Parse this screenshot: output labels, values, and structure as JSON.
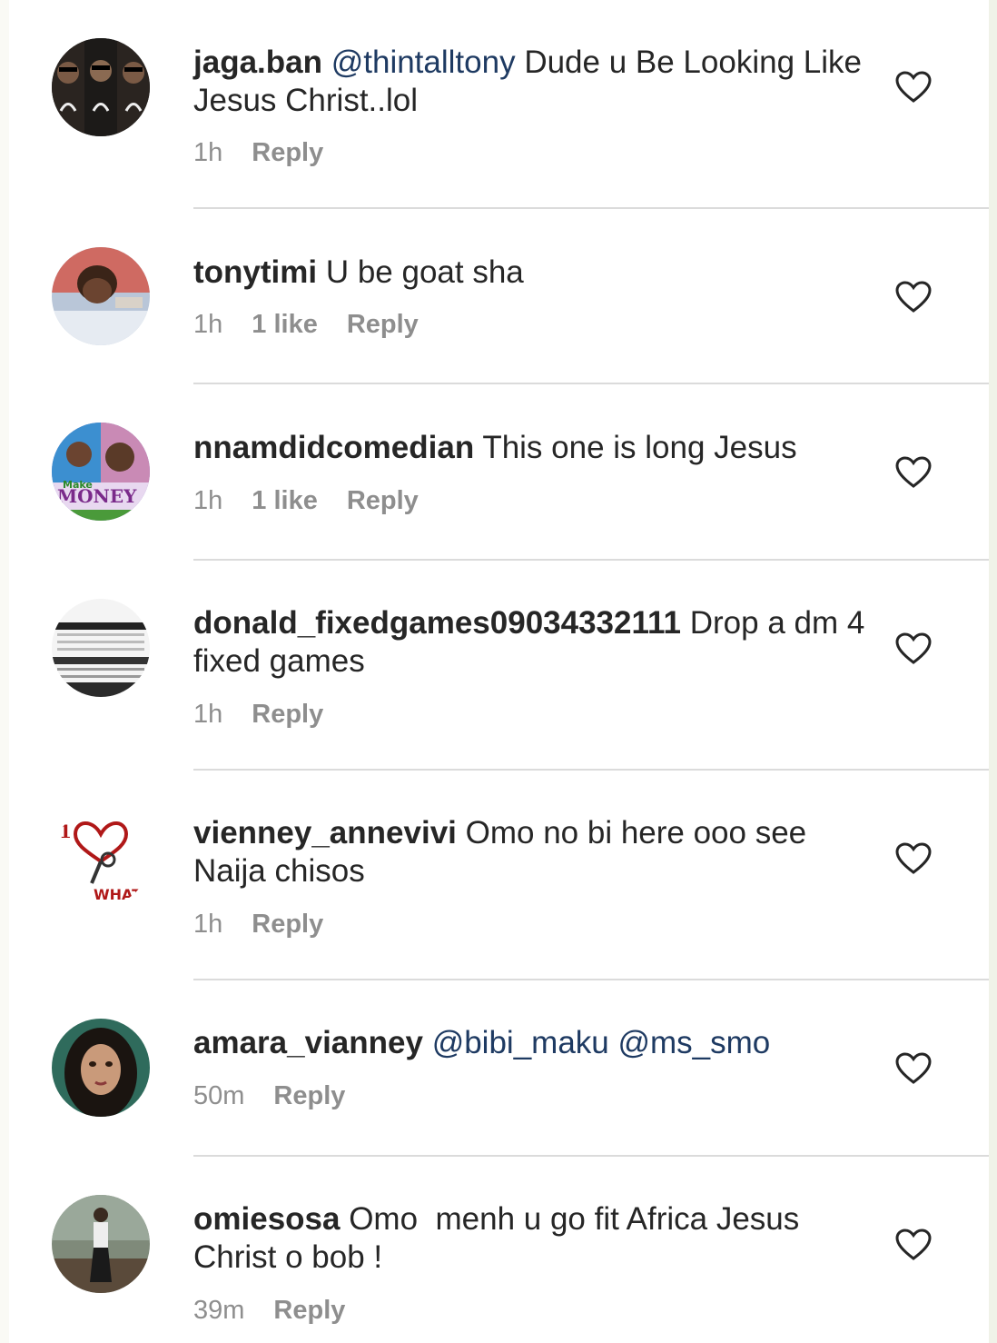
{
  "comments": [
    {
      "username": "jaga.ban",
      "mention1": "@thintalltony",
      "text": "Dude u Be Looking Like Jesus Christ..lol",
      "time": "1h",
      "reply": "Reply"
    },
    {
      "username": "tonytimi",
      "text": "U be goat sha",
      "time": "1h",
      "likes": "1 like",
      "reply": "Reply"
    },
    {
      "username": "nnamdidcomedian",
      "text": "This one is long Jesus",
      "time": "1h",
      "likes": "1 like",
      "reply": "Reply"
    },
    {
      "username": "donald_fixedgames09034332111",
      "text": "Drop a dm 4 fixed games",
      "time": "1h",
      "reply": "Reply"
    },
    {
      "username": "vienney_annevivi",
      "text": "Omo no bi here ooo see Naija chisos",
      "time": "1h",
      "reply": "Reply"
    },
    {
      "username": "amara_vianney",
      "mention1": "@bibi_maku",
      "mention2": "@ms_smo",
      "time": "50m",
      "reply": "Reply"
    },
    {
      "username": "omiesosa",
      "text": "Omo  menh u go fit Africa Jesus Christ o bob !",
      "time": "39m",
      "reply": "Reply"
    }
  ],
  "avatar_texts": {
    "nnamdi": "MONEY",
    "nnamdi_small": "Make",
    "vienney": "WHAT I D"
  },
  "icons": {
    "like": "heart-outline-icon"
  },
  "colors": {
    "text": "#262626",
    "meta": "#8e8e8e",
    "mention": "#1e3a62",
    "divider": "#dbdbdb"
  }
}
